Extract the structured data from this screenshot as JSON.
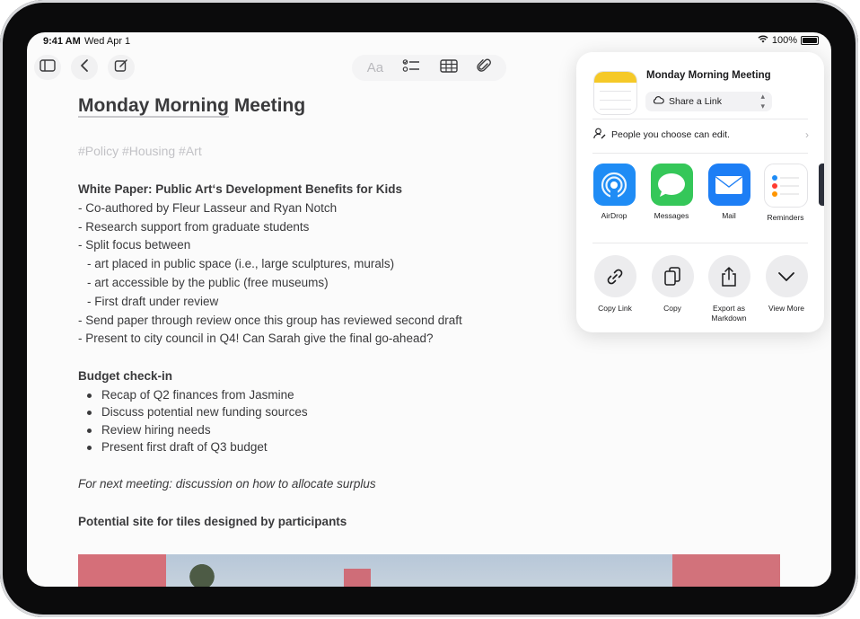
{
  "status": {
    "time": "9:41 AM",
    "date": "Wed Apr 1",
    "battery": "100%"
  },
  "toolbar": {
    "format_label": "Aa"
  },
  "note": {
    "title_part1": "Monday Morning",
    "title_part2": " Meeting",
    "tags": "#Policy #Housing #Art",
    "lines": [
      "White Paper: Public Art‘s Development Benefits for Kids",
      "- Co-authored by Fleur Lasseur and Ryan Notch",
      "- Research support from graduate students",
      "- Split focus between",
      "- art placed in public space (i.e., large sculptures, murals)",
      "- art accessible by the public (free museums)",
      "- First draft under review",
      "- Send paper through review once this group has reviewed second draft",
      "- Present to city council in Q4! Can Sarah give the final go-ahead?"
    ],
    "budget_heading": "Budget check-in",
    "budget_items": [
      "Recap of Q2 finances from Jasmine",
      "Discuss potential new funding sources",
      "Review hiring needs",
      "Present first draft of Q3 budget"
    ],
    "next_meeting": "For next meeting: discussion on how to allocate surplus",
    "site_heading": "Potential site for tiles designed by participants"
  },
  "share": {
    "title": "Monday Morning Meeting",
    "link_option": "Share a Link",
    "permission": "People you choose can edit.",
    "apps": [
      {
        "label": "AirDrop",
        "color": "#1f8cf5"
      },
      {
        "label": "Messages",
        "color": "#35c759"
      },
      {
        "label": "Mail",
        "color": "#1d7ef5"
      },
      {
        "label": "Reminders",
        "color": "#ffffff"
      }
    ],
    "actions": [
      {
        "label": "Copy Link"
      },
      {
        "label": "Copy"
      },
      {
        "label": "Export as Markdown"
      },
      {
        "label": "View More"
      }
    ]
  }
}
